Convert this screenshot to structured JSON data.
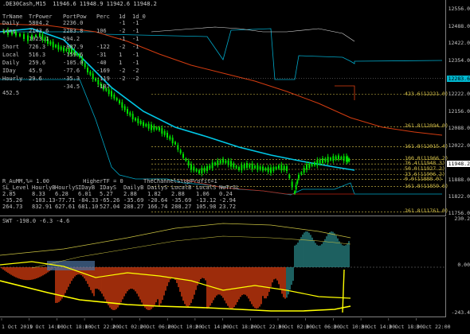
{
  "window": {
    "title": ".DE30Cash,M15  11946.6 11948.9 11942.6 11948.2"
  },
  "stats_table": {
    "headers": [
      "TrName",
      "TrPower",
      "PortPow",
      "Perc",
      "1d",
      "1d_0"
    ],
    "rows": [
      [
        "Daily",
        "5804.2",
        "2236.0",
        "",
        "-1",
        "-1"
      ],
      [
        "Long",
        "2143.6",
        "2283.8",
        "106",
        "-2",
        "-1"
      ],
      [
        "",
        "1023.1",
        "594.2",
        "",
        "-1",
        "-1"
      ],
      [
        "Short",
        "726.3",
        "-887.9",
        "-122",
        "-2",
        "-1"
      ],
      [
        "Local",
        "516.3",
        "-159.6",
        "-31",
        "1",
        "-1"
      ],
      [
        "Daily",
        "259.6",
        "-105.0",
        "-40",
        "1",
        "-1"
      ],
      [
        "IDay",
        "45.9",
        "-77.6",
        "-169",
        "-2",
        "-2"
      ],
      [
        "Hourly",
        "29.6",
        "-35.3",
        "-119",
        "-2",
        "-2"
      ],
      [
        "",
        "",
        "-34.5",
        "-107",
        "",
        ""
      ]
    ],
    "extra_value": "452.5"
  },
  "params_table": {
    "line1": "R_AuMM,%= 1.00          HigherTF = 0      TheChannelStopProfit=1",
    "headers": [
      "SL_Level",
      "HourlyB",
      "HourlyS",
      "IDayB",
      "IDayS",
      "DailyB",
      "DailyS",
      "LocalB",
      "LocalS",
      "NoTrSL"
    ],
    "rows": [
      [
        "2.85",
        "8.33",
        "6.28",
        "6.01",
        "5.27",
        "2.88",
        "1.82",
        "2.88",
        "1.06",
        "0.24"
      ],
      [
        "-35.26",
        "-103.13",
        "-77.71",
        "-84.33",
        "-65.26",
        "-35.69",
        "-20.64",
        "-35.69",
        "-13.12",
        "-2.94"
      ],
      [
        "264.73",
        "832.91",
        "627.61",
        "681.10",
        "527.04",
        "288.27",
        "166.74",
        "288.27",
        "105.98",
        "23.72"
      ]
    ]
  },
  "price_axis": {
    "labels": [
      "12556.0",
      "12488.0",
      "12422.0",
      "12354.0",
      "12222.0",
      "12156.0",
      "12088.0",
      "12022.0",
      "11888.0",
      "11822.0",
      "11756.0"
    ],
    "current_price": "11948.2",
    "highlight_price": "12283.6"
  },
  "level_tags": [
    {
      "label": "423.6(12221.0)",
      "price": 12221,
      "color": "#d8c34a"
    },
    {
      "label": "261.8(12094.0)",
      "price": 12094,
      "color": "#d8c34a"
    },
    {
      "label": "161.8(12015.4)",
      "price": 12015.4,
      "color": "#d8c34a"
    },
    {
      "label": "100.0(11966.2)",
      "price": 11966.2,
      "color": "#d8c34a"
    },
    {
      "label": "76.4(11948.3)",
      "price": 11948.3,
      "color": "#d8c34a"
    },
    {
      "label": "50.0(11927.2)",
      "price": 11927.2,
      "color": "#d8c34a"
    },
    {
      "label": "23.6(11906.2)",
      "price": 11906.2,
      "color": "#d8c34a"
    },
    {
      "label": "0.0(11888.0)",
      "price": 11888.0,
      "color": "#d8c34a"
    },
    {
      "label": "161.8(11859.6)",
      "price": 11859.6,
      "color": "#d8c34a"
    },
    {
      "label": "261.8(11761.0)",
      "price": 11761.0,
      "color": "#d8c34a"
    }
  ],
  "sub_window": {
    "title": "SWT -198.0 -6.3 -4.6",
    "axis_labels": [
      "230.2",
      "0.00",
      "-243.4"
    ]
  },
  "time_axis": {
    "labels": [
      "1 Oct 2019",
      "1 Oct 14:00",
      "1 Oct 18:00",
      "1 Oct 22:00",
      "2 Oct 02:00",
      "2 Oct 06:00",
      "2 Oct 10:00",
      "2 Oct 14:00",
      "2 Oct 18:00",
      "2 Oct 22:00",
      "3 Oct 02:00",
      "3 Oct 06:00",
      "3 Oct 10:00",
      "3 Oct 14:00",
      "3 Oct 18:00",
      "3 Oct 22:00"
    ]
  },
  "colors": {
    "background": "#000000",
    "candle": "#00e000",
    "ma_fast": "#00c8e6",
    "ma_slow": "#d43c10",
    "channel": "#00a8c8",
    "fib": "#d8c34a",
    "hist_pos": "#e04010",
    "hist_neg": "#6aa0e0",
    "sub_line": "#ffff00"
  }
}
